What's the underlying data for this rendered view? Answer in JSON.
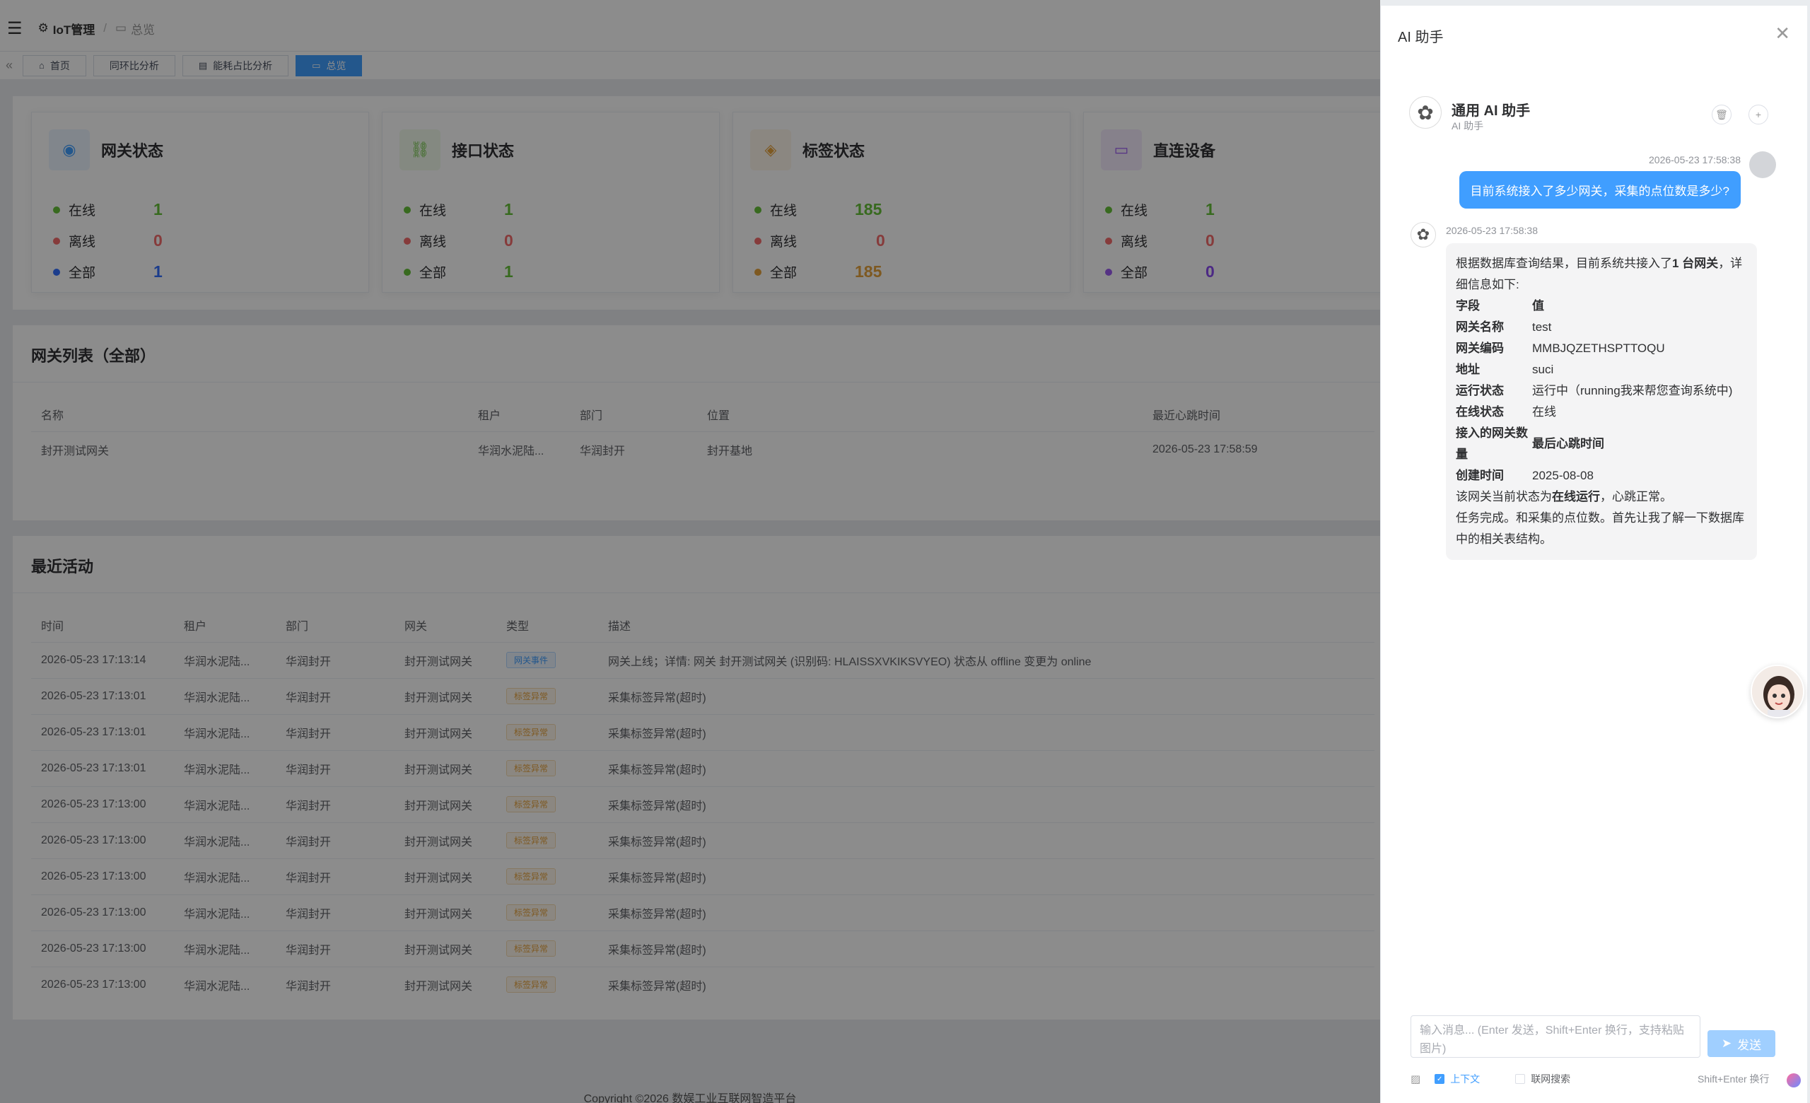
{
  "breadcrumb": {
    "app": "IoT管理",
    "page": "总览"
  },
  "tabs": [
    {
      "label": "首页",
      "icon": "home-icon"
    },
    {
      "label": "同环比分析",
      "icon": ""
    },
    {
      "label": "能耗占比分析",
      "icon": "doc-icon"
    },
    {
      "label": "总览",
      "icon": "monitor-icon"
    }
  ],
  "stats": [
    {
      "title": "网关状态",
      "color": "#409eff",
      "online_label": "在线",
      "online": "1",
      "offline_label": "离线",
      "offline": "0",
      "all_label": "全部",
      "all": "1",
      "all_color": "#3370ff"
    },
    {
      "title": "接口状态",
      "color": "#67c23a",
      "online_label": "在线",
      "online": "1",
      "offline_label": "离线",
      "offline": "0",
      "all_label": "全部",
      "all": "1",
      "all_color": "#67c23a"
    },
    {
      "title": "标签状态",
      "color": "#e6a23c",
      "online_label": "在线",
      "online": "185",
      "offline_label": "离线",
      "offline": "0",
      "all_label": "全部",
      "all": "185",
      "all_color": "#e6a23c"
    },
    {
      "title": "直连设备",
      "color": "#9c5cf0",
      "online_label": "在线",
      "online": "1",
      "offline_label": "离线",
      "offline": "0",
      "all_label": "全部",
      "all": "0",
      "all_color": "#8a4cf0"
    }
  ],
  "gateway_list": {
    "title": "网关列表（全部）",
    "columns": [
      "名称",
      "租户",
      "部门",
      "位置",
      "最近心跳时间"
    ],
    "rows": [
      [
        "封开测试网关",
        "华润水泥陆...",
        "华润封开",
        "封开基地",
        "2026-05-23 17:58:59"
      ]
    ]
  },
  "activity": {
    "title": "最近活动",
    "columns": [
      "时间",
      "租户",
      "部门",
      "网关",
      "类型",
      "描述"
    ],
    "rows": [
      [
        "2026-05-23 17:13:14",
        "华润水泥陆...",
        "华润封开",
        "封开测试网关",
        "网关事件",
        "网关上线；详情: 网关 封开测试网关 (识别码: HLAISSXVKIKSVYEO) 状态从 offline 变更为 online"
      ],
      [
        "2026-05-23 17:13:01",
        "华润水泥陆...",
        "华润封开",
        "封开测试网关",
        "标签异常",
        "采集标签异常(超时)"
      ],
      [
        "2026-05-23 17:13:01",
        "华润水泥陆...",
        "华润封开",
        "封开测试网关",
        "标签异常",
        "采集标签异常(超时)"
      ],
      [
        "2026-05-23 17:13:01",
        "华润水泥陆...",
        "华润封开",
        "封开测试网关",
        "标签异常",
        "采集标签异常(超时)"
      ],
      [
        "2026-05-23 17:13:00",
        "华润水泥陆...",
        "华润封开",
        "封开测试网关",
        "标签异常",
        "采集标签异常(超时)"
      ],
      [
        "2026-05-23 17:13:00",
        "华润水泥陆...",
        "华润封开",
        "封开测试网关",
        "标签异常",
        "采集标签异常(超时)"
      ],
      [
        "2026-05-23 17:13:00",
        "华润水泥陆...",
        "华润封开",
        "封开测试网关",
        "标签异常",
        "采集标签异常(超时)"
      ],
      [
        "2026-05-23 17:13:00",
        "华润水泥陆...",
        "华润封开",
        "封开测试网关",
        "标签异常",
        "采集标签异常(超时)"
      ],
      [
        "2026-05-23 17:13:00",
        "华润水泥陆...",
        "华润封开",
        "封开测试网关",
        "标签异常",
        "采集标签异常(超时)"
      ],
      [
        "2026-05-23 17:13:00",
        "华润水泥陆...",
        "华润封开",
        "封开测试网关",
        "标签异常",
        "采集标签异常(超时)"
      ]
    ]
  },
  "footer": "Copyright ©2026 数娱工业互联网智造平台",
  "ai": {
    "panel_title": "AI 助手",
    "bot_name": "通用 AI 助手",
    "bot_sub": "AI 助手",
    "user_time": "2026-05-23 17:58:38",
    "user_msg": "目前系统接入了多少网关，采集的点位数是多少?",
    "bot_time": "2026-05-23 17:58:38",
    "reply_intro_a": "根据数据库查询结果，目前系统共接入了",
    "reply_intro_b": "1 台网关",
    "reply_intro_c": "，详细信息如下:",
    "kv": [
      [
        "字段",
        "值"
      ],
      [
        "网关名称",
        "test"
      ],
      [
        "网关编码",
        "MMBJQZETHSPTTOQU"
      ],
      [
        "地址",
        "suci"
      ],
      [
        "运行状态",
        "运行中（running我来帮您查询系统中)"
      ],
      [
        "在线状态",
        "在线"
      ],
      [
        "接入的网关数量",
        "最后心跳时间"
      ],
      [
        "创建时间",
        "2025-08-08"
      ]
    ],
    "reply_status_a": "该网关当前状态为",
    "reply_status_b": "在线运行",
    "reply_status_c": "，心跳正常。",
    "reply_tail": "任务完成。和采集的点位数。首先让我了解一下数据库中的相关表结构。",
    "input_placeholder": "输入消息... (Enter 发送，Shift+Enter 换行，支持粘贴图片)",
    "send_label": "发送",
    "context_label": "上下文",
    "web_label": "联网搜索",
    "hint": "Shift+Enter 换行"
  }
}
